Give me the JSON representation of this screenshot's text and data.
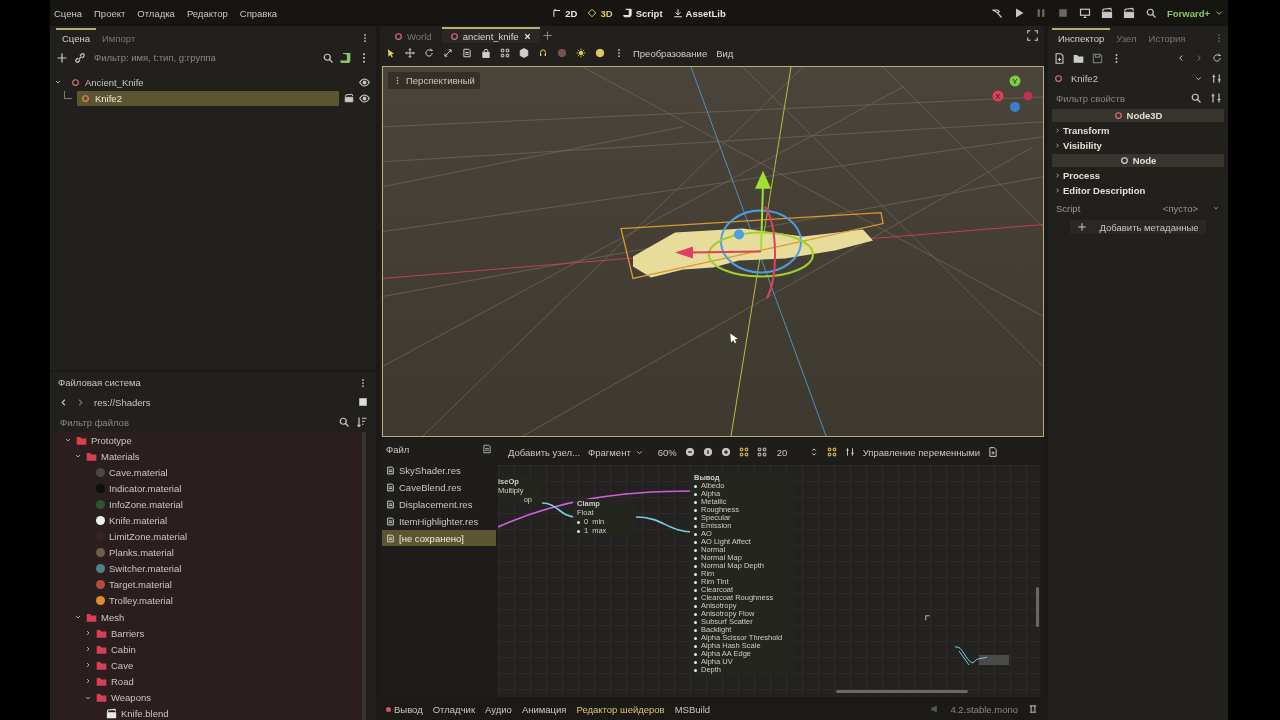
{
  "menubar": {
    "menu": [
      "Сцена",
      "Проект",
      "Отладка",
      "Редактор",
      "Справка"
    ],
    "main_screens": [
      {
        "label": "2D",
        "selected": false
      },
      {
        "label": "3D",
        "selected": true
      },
      {
        "label": "Script",
        "selected": false
      },
      {
        "label": "AssetLib",
        "selected": false
      }
    ],
    "renderer": "Forward+"
  },
  "scene_dock": {
    "tabs": [
      {
        "label": "Сцена",
        "selected": true
      },
      {
        "label": "Импорт",
        "selected": false
      }
    ],
    "filter": {
      "placeholder": "Фильтр: имя, t:тип, g:группа"
    },
    "tree": [
      {
        "label": "Ancient_Knife",
        "selected": false,
        "expanded": true,
        "children": [
          {
            "label": "Knife2",
            "selected": true
          }
        ]
      }
    ]
  },
  "filesystem": {
    "title": "Файловая система",
    "path": "res://Shaders",
    "filter": {
      "placeholder": "Фильтр файлов"
    },
    "tree": [
      {
        "label": "Prototype",
        "kind": "folder",
        "expanded": true,
        "children": [
          {
            "label": "Materials",
            "kind": "folder",
            "expanded": true,
            "children": [
              {
                "label": "Cave.material",
                "kind": "material",
                "color": "#4a4846"
              },
              {
                "label": "Indicator.material",
                "kind": "material",
                "color": "#0e0e0e"
              },
              {
                "label": "InfoZone.material",
                "kind": "material",
                "color": "#2f5530"
              },
              {
                "label": "Knife.material",
                "kind": "material",
                "color": "#eeeeee"
              },
              {
                "label": "LimitZone.material",
                "kind": "material",
                "color": "#3a2222"
              },
              {
                "label": "Planks.material",
                "kind": "material",
                "color": "#6e5e44"
              },
              {
                "label": "Switcher.material",
                "kind": "material",
                "color": "#4c8288"
              },
              {
                "label": "Target.material",
                "kind": "material",
                "color": "#b44c42"
              },
              {
                "label": "Trolley.material",
                "kind": "material",
                "color": "#e08c32"
              }
            ]
          },
          {
            "label": "Mesh",
            "kind": "folder",
            "expanded": true,
            "children": [
              {
                "label": "Barriers",
                "kind": "folder",
                "expanded": false
              },
              {
                "label": "Cabin",
                "kind": "folder",
                "expanded": false
              },
              {
                "label": "Cave",
                "kind": "folder",
                "expanded": false
              },
              {
                "label": "Road",
                "kind": "folder",
                "expanded": false
              },
              {
                "label": "Weapons",
                "kind": "folder",
                "expanded": true,
                "children": [
                  {
                    "label": "Knife.blend",
                    "kind": "scene"
                  }
                ]
              }
            ]
          }
        ]
      }
    ]
  },
  "editor_tabs": [
    {
      "label": "World",
      "selected": false
    },
    {
      "label": "ancient_knife",
      "selected": true
    }
  ],
  "viewport_toolbar": {
    "menus": [
      "Преобразование",
      "Вид"
    ]
  },
  "viewport": {
    "view_menu": "Перспективный",
    "gizmo_labels": [
      "Y",
      "X"
    ]
  },
  "shader_editor": {
    "files_title": "Файл",
    "files": [
      {
        "label": "SkyShader.res",
        "selected": false
      },
      {
        "label": "CaveBlend.res",
        "selected": false
      },
      {
        "label": "Displacement.res",
        "selected": false
      },
      {
        "label": "ItemHighlighter.res",
        "selected": false
      },
      {
        "label": "[не сохранено]",
        "selected": true
      }
    ],
    "add_node": "Добавить узел...",
    "mode": "Фрагмент",
    "zoom": "60%",
    "snap": "20",
    "manage": "Управление переменными",
    "nodes": {
      "op_node": {
        "title": "iseOp",
        "operator": "Multiply",
        "port": "op"
      },
      "clamp_node": {
        "title": "Clamp",
        "type": "Float",
        "rows": [
          {
            "value": "0",
            "name": "min"
          },
          {
            "value": "1",
            "name": "max"
          }
        ]
      },
      "output_node": {
        "title": "Вывод",
        "ports": [
          "Albedo",
          "Alpha",
          "Metallic",
          "Roughness",
          "Specular",
          "Emission",
          "AO",
          "AO Light Affect",
          "Normal",
          "Normal Map",
          "Normal Map Depth",
          "Rim",
          "Rim Tint",
          "Clearcoat",
          "Clearcoat Roughness",
          "Anisotropy",
          "Anisotropy Flow",
          "Subsurf Scatter",
          "Backlight",
          "Alpha Scissor Threshold",
          "Alpha Hash Scale",
          "Alpha AA Edge",
          "Alpha UV",
          "Depth"
        ]
      }
    }
  },
  "bottom_bar": {
    "tabs": [
      {
        "label": "Вывод",
        "selected": false,
        "alert": true
      },
      {
        "label": "Отладчик",
        "selected": false,
        "alert": false
      },
      {
        "label": "Аудио",
        "selected": false,
        "alert": false
      },
      {
        "label": "Анимация",
        "selected": false,
        "alert": false
      },
      {
        "label": "Редактор шейдеров",
        "selected": true,
        "alert": false
      },
      {
        "label": "MSBuild",
        "selected": false,
        "alert": false
      }
    ],
    "version": "4.2.stable.mono"
  },
  "inspector": {
    "tabs": [
      {
        "label": "Инспектор",
        "selected": true
      },
      {
        "label": "Узел",
        "selected": false
      },
      {
        "label": "История",
        "selected": false
      }
    ],
    "node": "Knife2",
    "filter": {
      "placeholder": "Фильтр свойств"
    },
    "sections": [
      {
        "kind": "class",
        "label": "Node3D"
      },
      {
        "kind": "group",
        "label": "Transform"
      },
      {
        "kind": "group",
        "label": "Visibility"
      },
      {
        "kind": "class",
        "label": "Node"
      },
      {
        "kind": "group",
        "label": "Process"
      },
      {
        "kind": "group",
        "label": "Editor Description"
      },
      {
        "kind": "property",
        "label": "Script",
        "value": "<пусто>"
      }
    ],
    "add_button": "Добавить метаданные"
  }
}
